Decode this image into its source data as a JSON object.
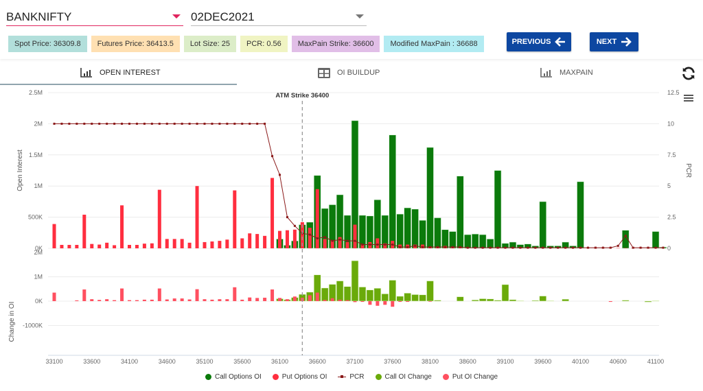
{
  "header": {
    "symbol": "BANKNIFTY",
    "expiry": "02DEC2021",
    "chips": [
      {
        "label": "Spot Price: 36309.8",
        "color": "#b2dfdb"
      },
      {
        "label": "Futures Price: 36413.5",
        "color": "#ffe0b2"
      },
      {
        "label": "Lot Size: 25",
        "color": "#dcedc8"
      },
      {
        "label": "PCR: 0.56",
        "color": "#f0f4c3"
      },
      {
        "label": "MaxPain Strike: 36600",
        "color": "#e1bee7"
      },
      {
        "label": "Modified MaxPain : 36688",
        "color": "#b2ebf2"
      }
    ],
    "prev_label": "PREVIOUS",
    "next_label": "NEXT"
  },
  "tabs": [
    {
      "label": "OPEN INTEREST",
      "icon": "bar-chart-icon",
      "active": true
    },
    {
      "label": "OI BUILDUP",
      "icon": "table-icon",
      "active": false
    },
    {
      "label": "MAXPAIN",
      "icon": "bar-chart-icon",
      "active": false
    }
  ],
  "colors": {
    "call_oi": "#0b7a0b",
    "put_oi": "#ff2e3f",
    "pcr": "#8b1a1a",
    "call_chg": "#6aaa0a",
    "put_chg": "#ff5060"
  },
  "chart_data": [
    {
      "type": "bar",
      "title": "",
      "annotation": "ATM Strike 36400",
      "atm_strike": 36400,
      "xlabel": "",
      "ylabel": "Open Interest",
      "y2label": "PCR",
      "ylim": [
        0,
        2500000
      ],
      "y2lim": [
        0,
        12.5
      ],
      "yticks": [
        "0K",
        "500K",
        "1M",
        "1.5M",
        "2M",
        "2.5M"
      ],
      "y2ticks": [
        "0",
        "2.5",
        "5",
        "7.5",
        "10",
        "12.5"
      ],
      "xticks": [
        "33100",
        "33600",
        "34100",
        "34600",
        "35100",
        "35600",
        "36100",
        "36600",
        "37100",
        "37600",
        "38100",
        "38600",
        "39100",
        "39600",
        "40100",
        "40600",
        "41100"
      ],
      "strikes": [
        33100,
        33200,
        33300,
        33400,
        33500,
        33600,
        33700,
        33800,
        33900,
        34000,
        34100,
        34200,
        34300,
        34400,
        34500,
        34600,
        34700,
        34800,
        34900,
        35000,
        35100,
        35200,
        35300,
        35400,
        35500,
        35600,
        35700,
        35800,
        35900,
        36000,
        36100,
        36200,
        36300,
        36400,
        36500,
        36600,
        36700,
        36800,
        36900,
        37000,
        37100,
        37200,
        37300,
        37400,
        37500,
        37600,
        37700,
        37800,
        37900,
        38000,
        38100,
        38200,
        38300,
        38400,
        38500,
        38600,
        38700,
        38800,
        38900,
        39000,
        39100,
        39200,
        39300,
        39400,
        39500,
        39600,
        39700,
        39800,
        39900,
        40000,
        40100,
        40200,
        40300,
        40400,
        40500,
        40600,
        40700,
        40800,
        40900,
        41000,
        41100,
        41200
      ],
      "series": [
        {
          "name": "Call Options OI",
          "values": [
            0,
            0,
            0,
            0,
            0,
            0,
            0,
            0,
            0,
            0,
            0,
            0,
            0,
            0,
            0,
            0,
            0,
            0,
            0,
            0,
            0,
            0,
            0,
            0,
            0,
            0,
            0,
            0,
            0,
            0,
            150000,
            50000,
            120000,
            380000,
            420000,
            1170000,
            640000,
            700000,
            860000,
            530000,
            2050000,
            530000,
            520000,
            780000,
            530000,
            1820000,
            550000,
            650000,
            630000,
            450000,
            1620000,
            490000,
            300000,
            270000,
            1160000,
            220000,
            230000,
            220000,
            150000,
            1250000,
            80000,
            100000,
            60000,
            70000,
            40000,
            750000,
            40000,
            40000,
            100000,
            40000,
            1070000,
            0,
            0,
            0,
            0,
            0,
            290000,
            0,
            0,
            0,
            270000,
            20000
          ]
        },
        {
          "name": "Put Options OI",
          "values": [
            390000,
            55000,
            55000,
            55000,
            540000,
            70000,
            60000,
            90000,
            50000,
            690000,
            55000,
            55000,
            75000,
            80000,
            940000,
            150000,
            150000,
            150000,
            90000,
            1000000,
            100000,
            110000,
            120000,
            140000,
            930000,
            160000,
            240000,
            230000,
            200000,
            1130000,
            280000,
            290000,
            300000,
            420000,
            330000,
            950000,
            150000,
            130000,
            180000,
            100000,
            380000,
            60000,
            100000,
            160000,
            80000,
            120000,
            60000,
            60000,
            60000,
            60000,
            20000,
            20000,
            40000,
            20000,
            10000,
            10000,
            10000,
            10000,
            10000,
            20000,
            5000,
            5000,
            5000,
            5000,
            5000,
            5000,
            5000,
            5000,
            5000,
            5000,
            5000,
            5000,
            5000,
            5000,
            5000,
            5000,
            5000,
            5000,
            5000,
            5000,
            5000,
            5000
          ]
        },
        {
          "name": "PCR",
          "axis": "right",
          "values": [
            10,
            10,
            10,
            10,
            10,
            10,
            10,
            10,
            10,
            10,
            10,
            10,
            10,
            10,
            10,
            10,
            10,
            10,
            10,
            10,
            10,
            10,
            10,
            10,
            10,
            10,
            10,
            10,
            10,
            7.4,
            5.9,
            2.5,
            1.8,
            1.2,
            1.1,
            0.8,
            0.9,
            0.6,
            0.7,
            0.6,
            0.6,
            0.3,
            0.3,
            0.3,
            0.3,
            0.3,
            0.1,
            0.1,
            0.2,
            0.1,
            0.1,
            0.1,
            0.1,
            0.1,
            0.1,
            0.05,
            0.05,
            0.05,
            0.05,
            0.05,
            0.05,
            0.05,
            0.05,
            0.05,
            0.05,
            0.05,
            0.05,
            0.05,
            0.05,
            0.05,
            0.05,
            0.05,
            0.05,
            0.05,
            0.05,
            0.2,
            1.0,
            0.05,
            0.05,
            0.05,
            0.05,
            0.05
          ]
        }
      ]
    },
    {
      "type": "bar",
      "ylabel": "Change in OI",
      "ylim": [
        -2000000,
        2000000
      ],
      "yticks": [
        "-1000K",
        "0K",
        "1M",
        "2M"
      ],
      "series": [
        {
          "name": "Call OI Change",
          "values": [
            0,
            0,
            0,
            0,
            0,
            0,
            0,
            0,
            0,
            0,
            0,
            0,
            0,
            0,
            0,
            0,
            0,
            0,
            0,
            0,
            0,
            0,
            0,
            0,
            0,
            0,
            0,
            0,
            0,
            0,
            100000,
            60000,
            150000,
            280000,
            370000,
            1080000,
            540000,
            690000,
            830000,
            600000,
            1660000,
            580000,
            460000,
            530000,
            300000,
            860000,
            200000,
            330000,
            270000,
            260000,
            830000,
            40000,
            0,
            0,
            180000,
            0,
            50000,
            100000,
            90000,
            40000,
            680000,
            60000,
            20000,
            0,
            30000,
            210000,
            20000,
            0,
            80000,
            0,
            0,
            0,
            0,
            0,
            0,
            0,
            40000,
            0,
            0,
            -40000,
            20000,
            0
          ]
        },
        {
          "name": "Put OI Change",
          "values": [
            350000,
            0,
            0,
            30000,
            480000,
            80000,
            50000,
            80000,
            40000,
            520000,
            40000,
            40000,
            60000,
            60000,
            520000,
            70000,
            110000,
            110000,
            70000,
            490000,
            80000,
            60000,
            80000,
            80000,
            570000,
            60000,
            150000,
            130000,
            140000,
            480000,
            130000,
            80000,
            190000,
            140000,
            240000,
            350000,
            50000,
            120000,
            60000,
            40000,
            -40000,
            -30000,
            -150000,
            -190000,
            -150000,
            -230000,
            -30000,
            -30000,
            0,
            0,
            -20000,
            0,
            0,
            0,
            0,
            0,
            0,
            0,
            0,
            0,
            0,
            0,
            0,
            0,
            0,
            0,
            0,
            0,
            0,
            0,
            0,
            0,
            0,
            0,
            -30000,
            0,
            0,
            0,
            0,
            0,
            0,
            0
          ]
        }
      ]
    }
  ],
  "legend": [
    "Call Options OI",
    "Put Options OI",
    "PCR",
    "Call OI Change",
    "Put OI Change"
  ]
}
